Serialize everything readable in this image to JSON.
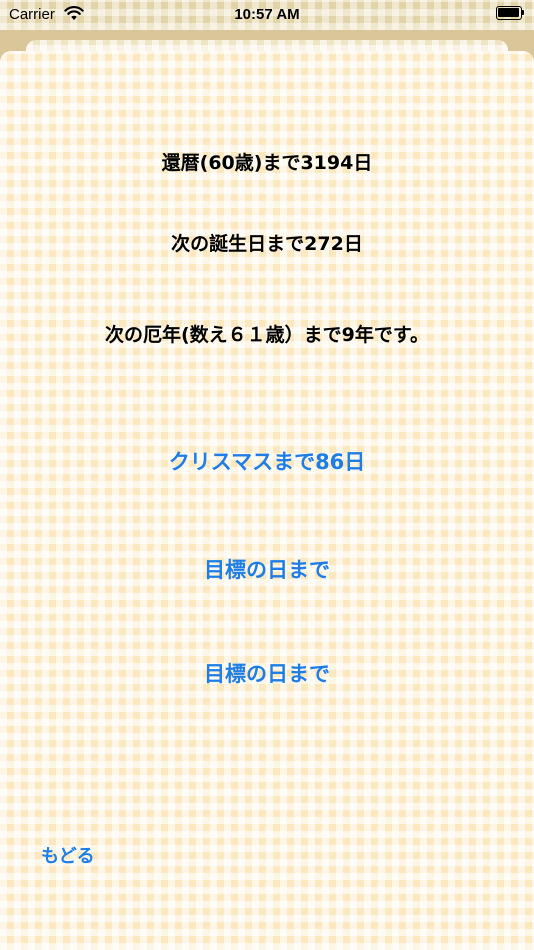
{
  "status_bar": {
    "carrier": "Carrier",
    "time": "10:57 AM",
    "wifi_icon": "wifi-icon",
    "battery_icon": "battery-icon"
  },
  "content": {
    "kanreki": "還暦(60歳)まで3194日",
    "birthday": "次の誕生日まで272日",
    "yakudoshi": "次の厄年(数え６１歳）まで9年です。",
    "christmas_button": "クリスマスまで86日",
    "target_button_1": "目標の日まで",
    "target_button_2": "目標の日まで"
  },
  "footer": {
    "back_label": "もどる"
  },
  "colors": {
    "accent": "#1f7ee6",
    "sheet_background": "#fbe8bf",
    "text": "#000000"
  }
}
